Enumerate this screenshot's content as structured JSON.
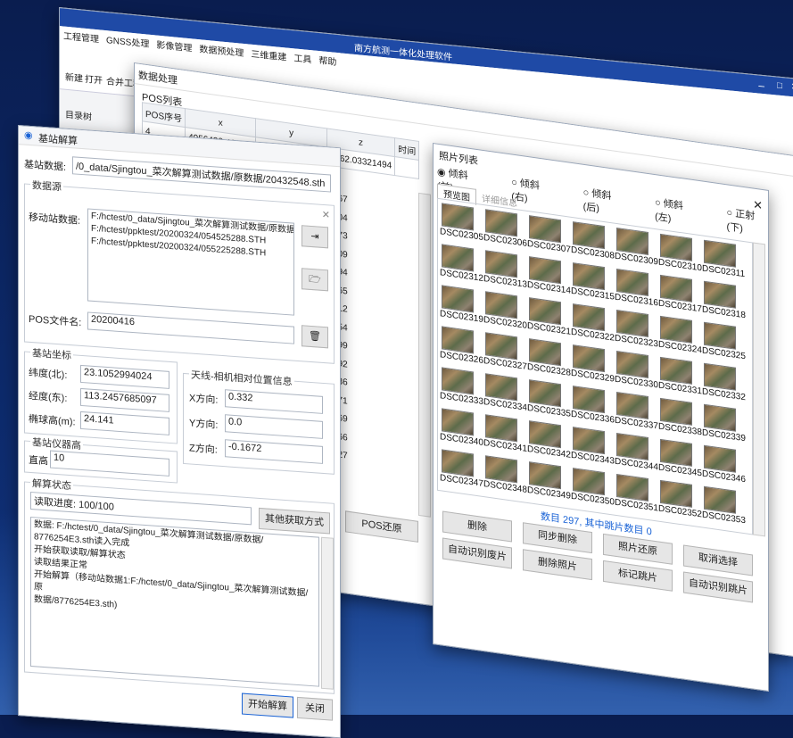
{
  "main": {
    "app_title": "南方航测一体化处理软件",
    "tabs": [
      "工程管理",
      "GNSS处理",
      "影像管理",
      "数据预处理",
      "三维重建",
      "工具",
      "帮助"
    ],
    "ribbon": [
      "新建",
      "打开",
      "合并工程"
    ],
    "tree_label": "目录树"
  },
  "dp": {
    "title": "数据处理",
    "pos_list_label": "POS列表",
    "columns": [
      "POS序号",
      "x",
      "y",
      "z",
      "时间"
    ],
    "first_row": [
      "4",
      "4056433.4681...",
      "474312.58186...",
      "1962.03321494",
      ""
    ],
    "right_col": [
      "167",
      "104",
      "173",
      "509",
      "794",
      "565",
      "312",
      "554",
      "399",
      "492",
      "336",
      "571",
      "469",
      "566",
      "127"
    ],
    "pos_restore": "POS还原"
  },
  "photo": {
    "title": "照片列表",
    "radios": [
      "倾斜(前)",
      "倾斜(右)",
      "倾斜(后)",
      "倾斜(左)",
      "正射(下)"
    ],
    "tabs": [
      "预览图",
      "详细信息"
    ],
    "start_num": 2305,
    "count_text": "数目 297, 其中跳片数目 0",
    "buttons": [
      "删除",
      "同步删除",
      "照片还原",
      "取消选择",
      "自动识别废片",
      "删除照片",
      "标记跳片",
      "自动识别跳片"
    ]
  },
  "solve": {
    "title": "基站解算",
    "base_data_label": "基站数据:",
    "base_data_value": "/0_data/Sjingtou_菜次解算测试数据/原数据/20432548.sth",
    "source_group": "数据源",
    "mobile_label": "移动站数据:",
    "mobile_lines": [
      "F:/hctest/0_data/Sjingtou_菜次解算测试数据/原数据/8776...",
      "F:/hctest/ppktest/20200324/054525288.STH",
      "F:/hctest/ppktest/20200324/055225288.STH"
    ],
    "pos_file_label": "POS文件名:",
    "pos_file_value": "20200416",
    "coord_group": "基站坐标",
    "lat_label": "纬度(北):",
    "lat_value": "23.1052994024",
    "lon_label": "经度(东):",
    "lon_value": "113.2457685097",
    "h_label": "椭球高(m):",
    "h_value": "24.141",
    "offset_group": "天线-相机相对位置信息",
    "x_label": "X方向:",
    "x_value": "0.332",
    "y_label": "Y方向:",
    "y_value": "0.0",
    "z_label": "Z方向:",
    "z_value": "-0.1672",
    "instr_group": "基站仪器高",
    "instr_label": "直高",
    "instr_value": "10",
    "status_group": "解算状态",
    "progress": "读取进度: 100/100",
    "other_btn": "其他获取方式",
    "log": [
      "数据: F:/hctest/0_data/Sjingtou_菜次解算测试数据/原数据/",
      "8776254E3.sth读入完成",
      "开始获取读取/解算状态",
      "读取结果正常",
      "开始解算（移动站数据1:F:/hctest/0_data/Sjingtou_菜次解算测试数据/原",
      "数据/8776254E3.sth)"
    ],
    "start_btn": "开始解算",
    "close_btn": "关闭"
  }
}
